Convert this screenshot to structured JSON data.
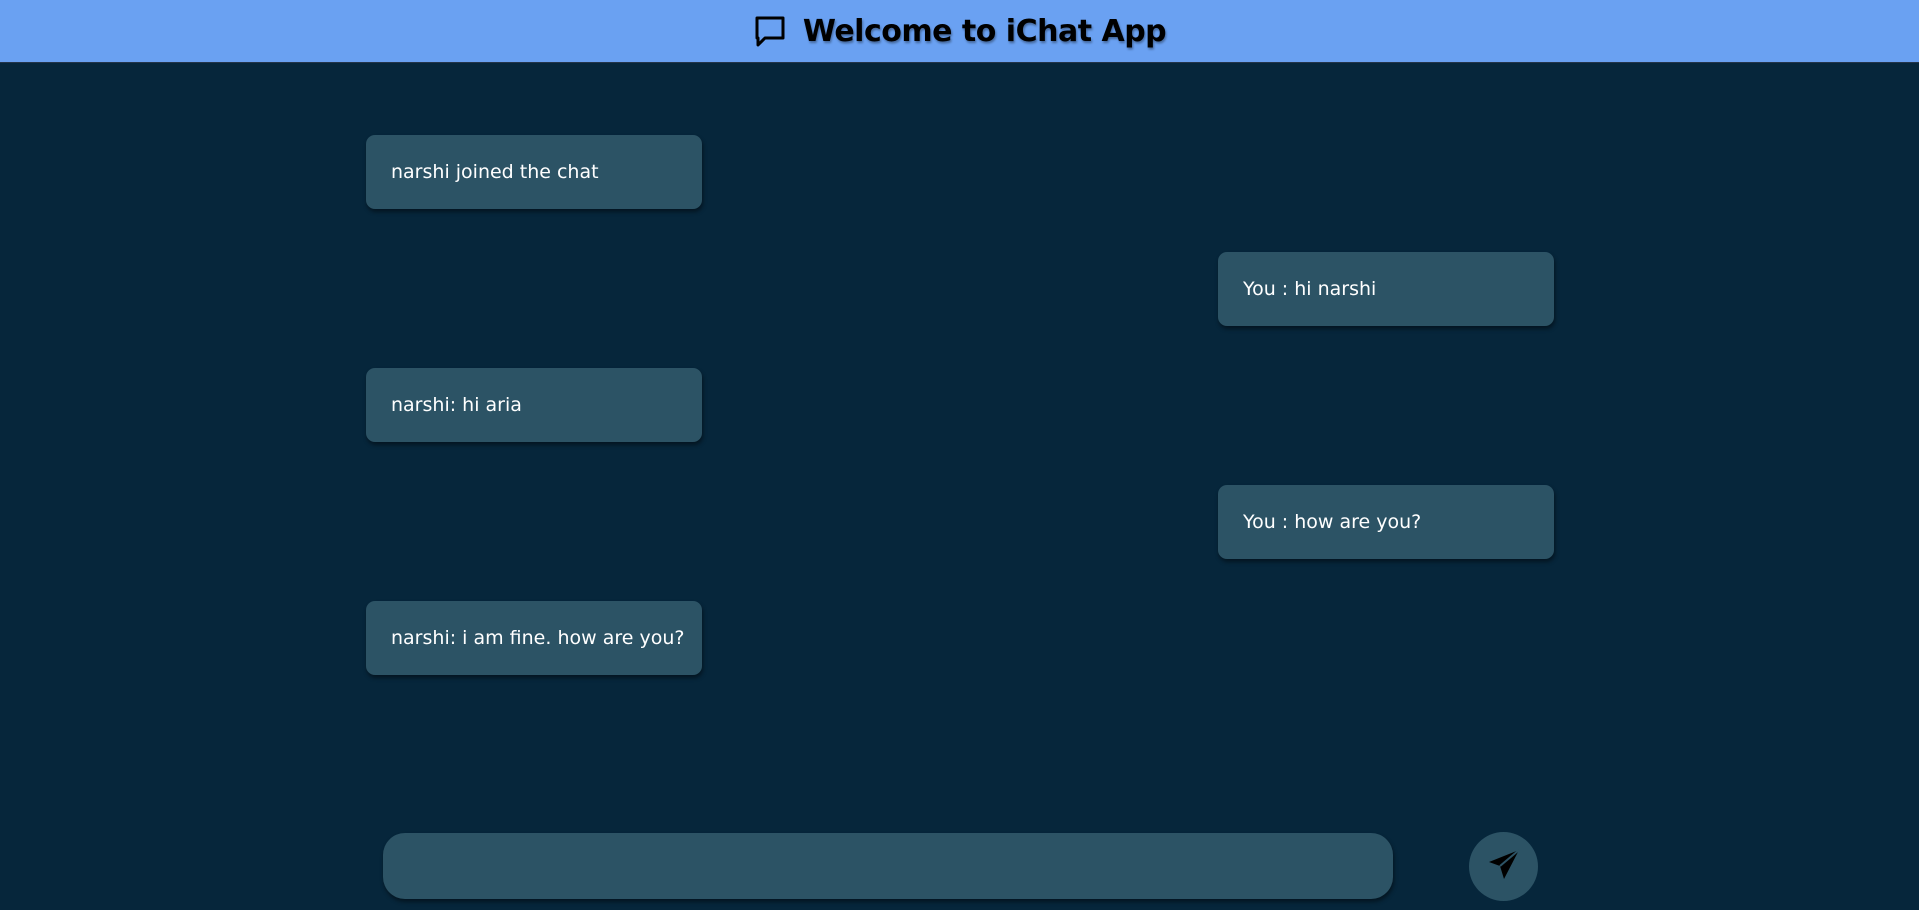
{
  "header": {
    "icon": "chat-bubble-icon",
    "title": "Welcome to iChat App"
  },
  "messages": [
    {
      "side": "left",
      "text": "narshi joined the chat"
    },
    {
      "side": "right",
      "text": "You : hi narshi"
    },
    {
      "side": "left",
      "text": "narshi: hi aria"
    },
    {
      "side": "right",
      "text": "You : how are you?"
    },
    {
      "side": "left",
      "text": "narshi: i am fine. how are you?"
    }
  ],
  "composer": {
    "value": "",
    "placeholder": ""
  },
  "send_button": {
    "icon": "paper-plane-icon"
  },
  "colors": {
    "header_bg": "#6aa1f2",
    "page_bg": "#06263b",
    "bubble_bg": "#2c5365",
    "text": "#ffffff"
  }
}
